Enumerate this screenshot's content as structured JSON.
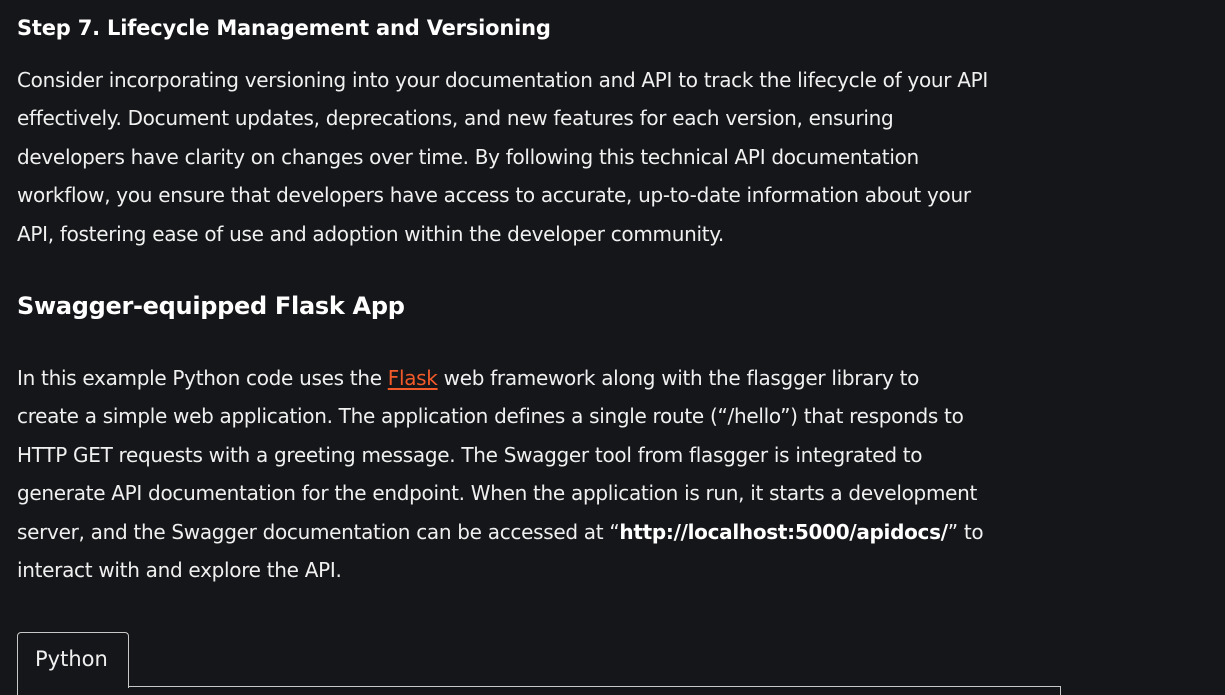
{
  "article": {
    "step_heading": "Step 7. Lifecycle Management and Versioning",
    "intro_lines": [
      "Consider incorporating versioning into your documentation and API to track the lifecycle of your API",
      "effectively. Document updates, deprecations, and new features for each version, ensuring",
      "developers have clarity on changes over time. By following this technical API documentation",
      "workflow, you ensure that developers have access to accurate, up-to-date information about your",
      "API, fostering ease of use and adoption within the developer community."
    ],
    "section_heading": "Swagger-equipped Flask App",
    "example": {
      "line1_before_link": "In this example Python code uses the ",
      "link_text": "Flask",
      "line1_after_link": " web framework along with the flasgger library to",
      "line2": "create a simple web application. The application defines a single route (“/hello”) that responds to",
      "line3": "HTTP GET requests with a greeting message. The Swagger tool from flasgger is integrated to",
      "line4": "generate API documentation for the endpoint. When the application is run, it starts a development",
      "line5_before_url": "server, and the Swagger documentation can be accessed at “",
      "url_text": "http://localhost:5000/apidocs/",
      "line5_after_url": "” to",
      "line6": "interact with and explore the API."
    },
    "code_block": {
      "tab_label": "Python"
    },
    "colors": {
      "background": "#151619",
      "text": "#f0f0f0",
      "link": "#f35a29",
      "border": "#c8c8c8"
    }
  }
}
